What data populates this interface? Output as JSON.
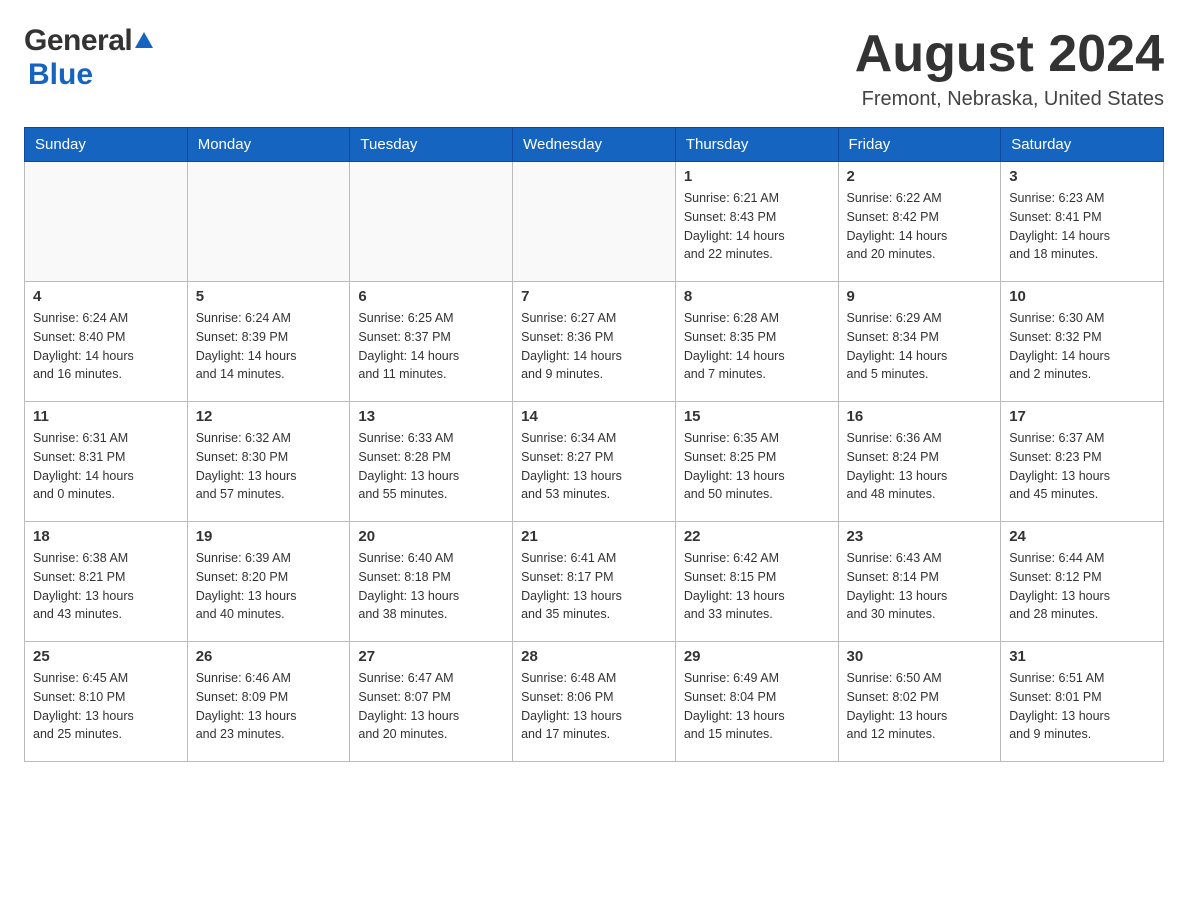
{
  "header": {
    "logo_general": "General",
    "logo_blue": "Blue",
    "month_title": "August 2024",
    "location": "Fremont, Nebraska, United States"
  },
  "days_of_week": [
    "Sunday",
    "Monday",
    "Tuesday",
    "Wednesday",
    "Thursday",
    "Friday",
    "Saturday"
  ],
  "weeks": [
    [
      {
        "day": "",
        "info": ""
      },
      {
        "day": "",
        "info": ""
      },
      {
        "day": "",
        "info": ""
      },
      {
        "day": "",
        "info": ""
      },
      {
        "day": "1",
        "info": "Sunrise: 6:21 AM\nSunset: 8:43 PM\nDaylight: 14 hours\nand 22 minutes."
      },
      {
        "day": "2",
        "info": "Sunrise: 6:22 AM\nSunset: 8:42 PM\nDaylight: 14 hours\nand 20 minutes."
      },
      {
        "day": "3",
        "info": "Sunrise: 6:23 AM\nSunset: 8:41 PM\nDaylight: 14 hours\nand 18 minutes."
      }
    ],
    [
      {
        "day": "4",
        "info": "Sunrise: 6:24 AM\nSunset: 8:40 PM\nDaylight: 14 hours\nand 16 minutes."
      },
      {
        "day": "5",
        "info": "Sunrise: 6:24 AM\nSunset: 8:39 PM\nDaylight: 14 hours\nand 14 minutes."
      },
      {
        "day": "6",
        "info": "Sunrise: 6:25 AM\nSunset: 8:37 PM\nDaylight: 14 hours\nand 11 minutes."
      },
      {
        "day": "7",
        "info": "Sunrise: 6:27 AM\nSunset: 8:36 PM\nDaylight: 14 hours\nand 9 minutes."
      },
      {
        "day": "8",
        "info": "Sunrise: 6:28 AM\nSunset: 8:35 PM\nDaylight: 14 hours\nand 7 minutes."
      },
      {
        "day": "9",
        "info": "Sunrise: 6:29 AM\nSunset: 8:34 PM\nDaylight: 14 hours\nand 5 minutes."
      },
      {
        "day": "10",
        "info": "Sunrise: 6:30 AM\nSunset: 8:32 PM\nDaylight: 14 hours\nand 2 minutes."
      }
    ],
    [
      {
        "day": "11",
        "info": "Sunrise: 6:31 AM\nSunset: 8:31 PM\nDaylight: 14 hours\nand 0 minutes."
      },
      {
        "day": "12",
        "info": "Sunrise: 6:32 AM\nSunset: 8:30 PM\nDaylight: 13 hours\nand 57 minutes."
      },
      {
        "day": "13",
        "info": "Sunrise: 6:33 AM\nSunset: 8:28 PM\nDaylight: 13 hours\nand 55 minutes."
      },
      {
        "day": "14",
        "info": "Sunrise: 6:34 AM\nSunset: 8:27 PM\nDaylight: 13 hours\nand 53 minutes."
      },
      {
        "day": "15",
        "info": "Sunrise: 6:35 AM\nSunset: 8:25 PM\nDaylight: 13 hours\nand 50 minutes."
      },
      {
        "day": "16",
        "info": "Sunrise: 6:36 AM\nSunset: 8:24 PM\nDaylight: 13 hours\nand 48 minutes."
      },
      {
        "day": "17",
        "info": "Sunrise: 6:37 AM\nSunset: 8:23 PM\nDaylight: 13 hours\nand 45 minutes."
      }
    ],
    [
      {
        "day": "18",
        "info": "Sunrise: 6:38 AM\nSunset: 8:21 PM\nDaylight: 13 hours\nand 43 minutes."
      },
      {
        "day": "19",
        "info": "Sunrise: 6:39 AM\nSunset: 8:20 PM\nDaylight: 13 hours\nand 40 minutes."
      },
      {
        "day": "20",
        "info": "Sunrise: 6:40 AM\nSunset: 8:18 PM\nDaylight: 13 hours\nand 38 minutes."
      },
      {
        "day": "21",
        "info": "Sunrise: 6:41 AM\nSunset: 8:17 PM\nDaylight: 13 hours\nand 35 minutes."
      },
      {
        "day": "22",
        "info": "Sunrise: 6:42 AM\nSunset: 8:15 PM\nDaylight: 13 hours\nand 33 minutes."
      },
      {
        "day": "23",
        "info": "Sunrise: 6:43 AM\nSunset: 8:14 PM\nDaylight: 13 hours\nand 30 minutes."
      },
      {
        "day": "24",
        "info": "Sunrise: 6:44 AM\nSunset: 8:12 PM\nDaylight: 13 hours\nand 28 minutes."
      }
    ],
    [
      {
        "day": "25",
        "info": "Sunrise: 6:45 AM\nSunset: 8:10 PM\nDaylight: 13 hours\nand 25 minutes."
      },
      {
        "day": "26",
        "info": "Sunrise: 6:46 AM\nSunset: 8:09 PM\nDaylight: 13 hours\nand 23 minutes."
      },
      {
        "day": "27",
        "info": "Sunrise: 6:47 AM\nSunset: 8:07 PM\nDaylight: 13 hours\nand 20 minutes."
      },
      {
        "day": "28",
        "info": "Sunrise: 6:48 AM\nSunset: 8:06 PM\nDaylight: 13 hours\nand 17 minutes."
      },
      {
        "day": "29",
        "info": "Sunrise: 6:49 AM\nSunset: 8:04 PM\nDaylight: 13 hours\nand 15 minutes."
      },
      {
        "day": "30",
        "info": "Sunrise: 6:50 AM\nSunset: 8:02 PM\nDaylight: 13 hours\nand 12 minutes."
      },
      {
        "day": "31",
        "info": "Sunrise: 6:51 AM\nSunset: 8:01 PM\nDaylight: 13 hours\nand 9 minutes."
      }
    ]
  ]
}
